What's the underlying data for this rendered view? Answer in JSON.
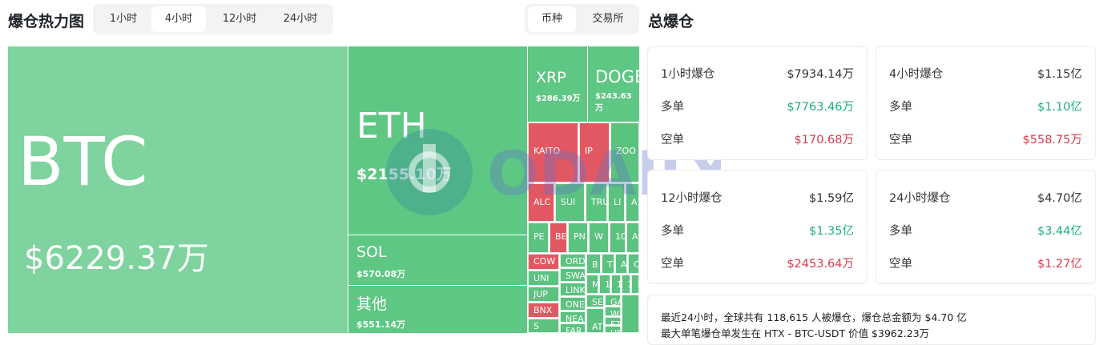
{
  "header": {
    "title": "爆仓热力图",
    "timeframes": [
      "1小时",
      "4小时",
      "12小时",
      "24小时"
    ],
    "active_timeframe": "4小时",
    "view_tabs": [
      "币种",
      "交易所"
    ],
    "active_view": "币种",
    "total_title": "总爆仓"
  },
  "treemap": {
    "btc": {
      "symbol": "BTC",
      "amount": "$6229.37万"
    },
    "eth": {
      "symbol": "ETH",
      "amount": "$2155.10万"
    },
    "sol": {
      "symbol": "SOL",
      "amount": "$570.08万"
    },
    "other": {
      "symbol": "其他",
      "amount": "$551.14万"
    },
    "xrp": {
      "symbol": "XRP",
      "amount": "$286.39万"
    },
    "doge": {
      "symbol": "DOGE",
      "amount": "$243.63万"
    },
    "small": [
      "KAITO",
      "IP",
      "ZOO",
      "ALC",
      "SUI",
      "TRU",
      "LI",
      "A",
      "PE",
      "BE",
      "PN",
      "W",
      "10",
      "AA",
      "COW",
      "ORD",
      "B",
      "T",
      "A",
      "C",
      "UNI",
      "SWA",
      "JUP",
      "LINK",
      "M",
      "1",
      "1",
      "1",
      "1",
      "BNX",
      "ONE",
      "SE",
      "GA",
      "NEA",
      "WL",
      "S",
      "FAR",
      "AT",
      "ET",
      "HE"
    ]
  },
  "totals": {
    "cards": [
      {
        "label": "1小时爆仓",
        "total": "$7934.14万",
        "long_label": "多单",
        "long": "$7763.46万",
        "short_label": "空单",
        "short": "$170.68万"
      },
      {
        "label": "4小时爆仓",
        "total": "$1.15亿",
        "long_label": "多单",
        "long": "$1.10亿",
        "short_label": "空单",
        "short": "$558.75万"
      },
      {
        "label": "12小时爆仓",
        "total": "$1.59亿",
        "long_label": "多单",
        "long": "$1.35亿",
        "short_label": "空单",
        "short": "$2453.64万"
      },
      {
        "label": "24小时爆仓",
        "total": "$4.70亿",
        "long_label": "多单",
        "long": "$3.44亿",
        "short_label": "空单",
        "short": "$1.27亿"
      }
    ]
  },
  "summary": {
    "line1": "最近24小时，全球共有 118,615 人被爆仓，爆仓总金额为 $4.70 亿",
    "line2": "最大单笔爆仓单发生在 HTX - BTC-USDT 价值 $3962.23万"
  },
  "watermark": {
    "text": "ODAILY"
  },
  "colors": {
    "long": "#1cae7e",
    "short": "#e03a4e",
    "btc_tile": "#7fd39e",
    "tile_green": "#5ec784",
    "tile_red": "#e25862"
  }
}
